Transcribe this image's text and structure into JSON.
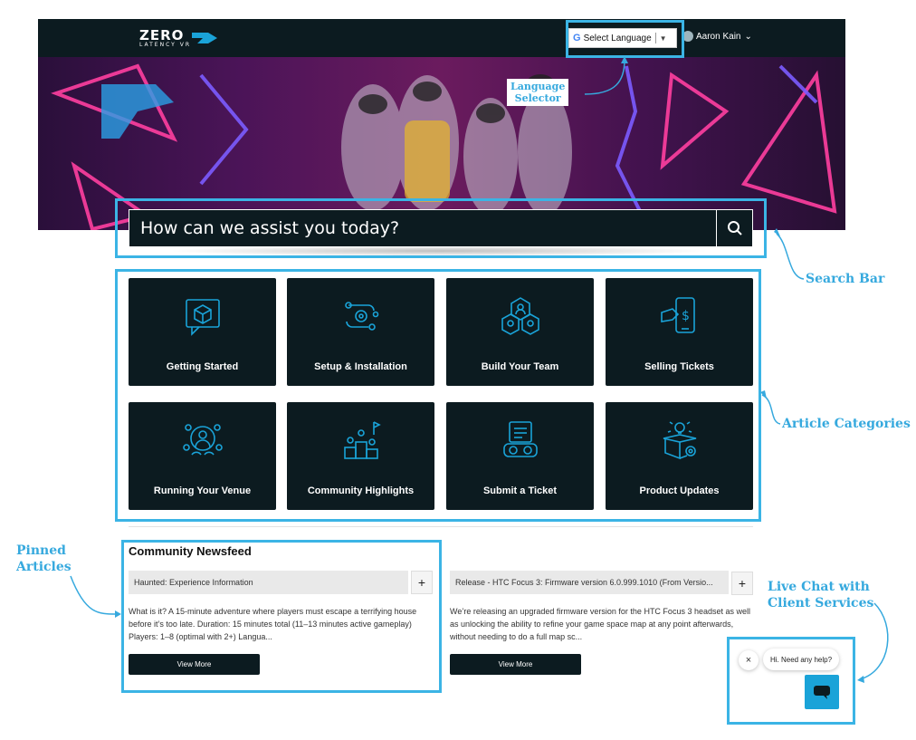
{
  "header": {
    "logo_main": "ZERO",
    "logo_sub": "LATENCY VR",
    "language_label": "Select Language",
    "user_name": "Aaron Kain",
    "user_chevron": "⌄"
  },
  "search": {
    "placeholder": "How can we assist you today?",
    "icon": "search-icon"
  },
  "categories": [
    {
      "label": "Getting Started",
      "icon": "cube-chat-icon"
    },
    {
      "label": "Setup & Installation",
      "icon": "gear-flow-icon"
    },
    {
      "label": "Build Your Team",
      "icon": "team-hexagon-icon"
    },
    {
      "label": "Selling Tickets",
      "icon": "phone-dollar-icon"
    },
    {
      "label": "Running Your Venue",
      "icon": "venue-people-icon"
    },
    {
      "label": "Community Highlights",
      "icon": "podium-flag-icon"
    },
    {
      "label": "Submit a Ticket",
      "icon": "vr-headset-ticket-icon"
    },
    {
      "label": "Product Updates",
      "icon": "box-lightbulb-icon"
    }
  ],
  "newsfeed": {
    "title": "Community Newsfeed",
    "articles": [
      {
        "title": "Haunted: Experience Information",
        "excerpt": "What is it? A 15-minute adventure where players must escape a terrifying house before it’s too late. Duration: 15 minutes total (11–13 minutes active gameplay) Players: 1–8 (optimal with 2+) Langua...",
        "button": "View More",
        "expand": "+"
      },
      {
        "title": "Release - HTC Focus 3: Firmware version 6.0.999.1010 (From Versio...",
        "excerpt": "We’re releasing an upgraded firmware version for the HTC Focus 3 headset as well as unlocking the ability to refine your game space map at any point afterwards, without needing to do a full map sc...",
        "button": "View More",
        "expand": "+"
      }
    ]
  },
  "chat": {
    "greeting": "Hi. Need any help?",
    "close": "×"
  },
  "annotations": {
    "language_selector": "Language\nSelector",
    "search_bar": "Search Bar",
    "article_categories": "Article Categories",
    "pinned_articles": "Pinned\nArticles",
    "live_chat": "Live Chat with\nClient Services"
  },
  "colors": {
    "dark": "#0c1b20",
    "accent": "#1aa3d8",
    "annotation": "#3bb4e5"
  }
}
